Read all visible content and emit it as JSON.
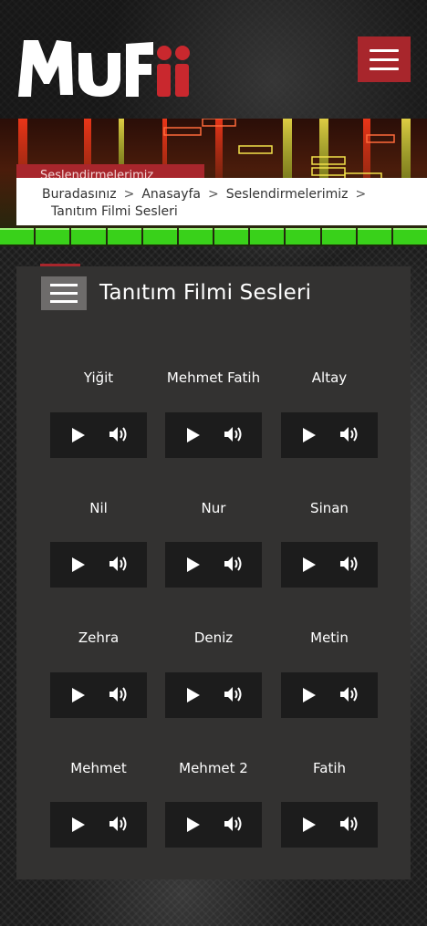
{
  "header": {
    "logo_text": "MUFii",
    "menu_icon": "hamburger-icon"
  },
  "banner": {
    "tag": "Seslendirmelerimiz",
    "breadcrumb": {
      "prefix": "Buradasınız",
      "items": [
        "Anasayfa",
        "Seslendirmelerimiz",
        "Tanıtım Filmi Sesleri"
      ],
      "separator": ">"
    }
  },
  "panel": {
    "title": "Tanıtım Filmi Sesleri",
    "menu_icon": "hamburger-icon",
    "voices": [
      {
        "name": "Yiğit"
      },
      {
        "name": "Mehmet Fatih"
      },
      {
        "name": "Altay"
      },
      {
        "name": "Nil"
      },
      {
        "name": "Nur"
      },
      {
        "name": "Sinan"
      },
      {
        "name": "Zehra"
      },
      {
        "name": "Deniz"
      },
      {
        "name": "Metin"
      },
      {
        "name": "Mehmet"
      },
      {
        "name": "Mehmet 2"
      },
      {
        "name": "Fatih"
      }
    ]
  },
  "colors": {
    "accent": "#a8262c",
    "panel": "#333231",
    "player": "#1c1c1c",
    "eq_green": "#39d11a"
  }
}
